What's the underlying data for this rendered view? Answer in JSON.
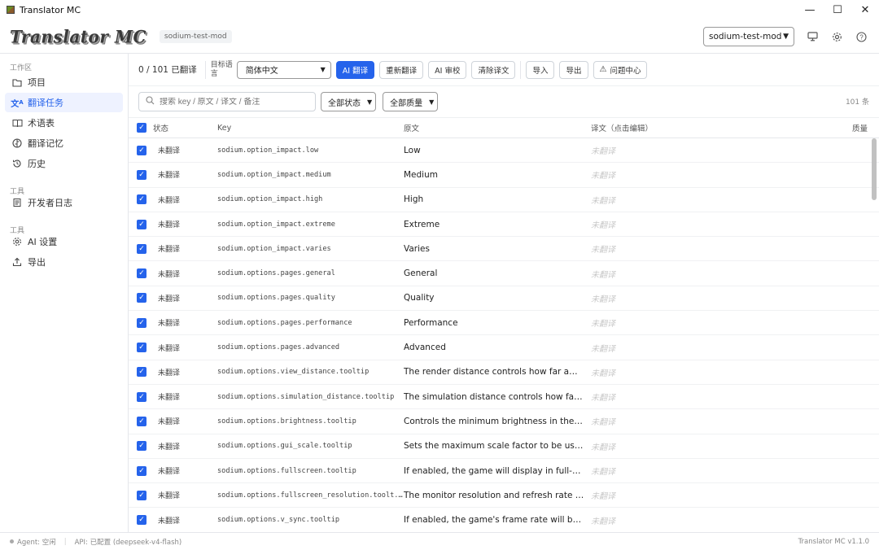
{
  "window": {
    "title": "Translator MC"
  },
  "header": {
    "logo": "Translator MC",
    "project_tag": "sodium-test-mod",
    "project_select": "sodium-test-mod"
  },
  "sidebar": {
    "sections": [
      {
        "title": "工作区",
        "items": [
          {
            "label": "项目",
            "icon": "folder-icon"
          },
          {
            "label": "翻译任务",
            "icon": "translate-icon",
            "active": true
          },
          {
            "label": "术语表",
            "icon": "book-icon"
          },
          {
            "label": "翻译记忆",
            "icon": "brain-icon"
          },
          {
            "label": "历史",
            "icon": "history-icon"
          }
        ]
      },
      {
        "title": "工具",
        "items": [
          {
            "label": "开发者日志",
            "icon": "log-icon"
          }
        ]
      },
      {
        "title": "工具",
        "items": [
          {
            "label": "AI 设置",
            "icon": "gear-icon"
          },
          {
            "label": "导出",
            "icon": "upload-icon"
          }
        ]
      }
    ]
  },
  "toolbar": {
    "progress": "0 / 101 已翻译",
    "target_label": "目标语言",
    "target_lang": "简体中文",
    "ai_translate": "AI 翻译",
    "retranslate": "重新翻译",
    "ai_review": "AI 审校",
    "clear": "清除译文",
    "import": "导入",
    "export": "导出",
    "issues": "问题中心"
  },
  "filters": {
    "search_placeholder": "搜索 key / 原文 / 译文 / 备注",
    "status": "全部状态",
    "quality": "全部质量",
    "count": "101 条"
  },
  "table": {
    "headers": {
      "status": "状态",
      "key": "Key",
      "source": "原文",
      "translation": "译文（点击编辑）",
      "quality": "质量"
    },
    "rows": [
      {
        "status": "未翻译",
        "key": "sodium.option_impact.low",
        "source": "Low",
        "translation": "未翻译"
      },
      {
        "status": "未翻译",
        "key": "sodium.option_impact.medium",
        "source": "Medium",
        "translation": "未翻译"
      },
      {
        "status": "未翻译",
        "key": "sodium.option_impact.high",
        "source": "High",
        "translation": "未翻译"
      },
      {
        "status": "未翻译",
        "key": "sodium.option_impact.extreme",
        "source": "Extreme",
        "translation": "未翻译"
      },
      {
        "status": "未翻译",
        "key": "sodium.option_impact.varies",
        "source": "Varies",
        "translation": "未翻译"
      },
      {
        "status": "未翻译",
        "key": "sodium.options.pages.general",
        "source": "General",
        "translation": "未翻译"
      },
      {
        "status": "未翻译",
        "key": "sodium.options.pages.quality",
        "source": "Quality",
        "translation": "未翻译"
      },
      {
        "status": "未翻译",
        "key": "sodium.options.pages.performance",
        "source": "Performance",
        "translation": "未翻译"
      },
      {
        "status": "未翻译",
        "key": "sodium.options.pages.advanced",
        "source": "Advanced",
        "translation": "未翻译"
      },
      {
        "status": "未翻译",
        "key": "sodium.options.view_distance.tooltip",
        "source": "The render distance controls how far away t...",
        "translation": "未翻译"
      },
      {
        "status": "未翻译",
        "key": "sodium.options.simulation_distance.tooltip",
        "source": "The simulation distance controls how far aw...",
        "translation": "未翻译"
      },
      {
        "status": "未翻译",
        "key": "sodium.options.brightness.tooltip",
        "source": "Controls the minimum brightness in the wor...",
        "translation": "未翻译"
      },
      {
        "status": "未翻译",
        "key": "sodium.options.gui_scale.tooltip",
        "source": "Sets the maximum scale factor to be used fo...",
        "translation": "未翻译"
      },
      {
        "status": "未翻译",
        "key": "sodium.options.fullscreen.tooltip",
        "source": "If enabled, the game will display in full-scree...",
        "translation": "未翻译"
      },
      {
        "status": "未翻译",
        "key": "sodium.options.fullscreen_resolution.toolt...",
        "source": "The monitor resolution and refresh rate to b...",
        "translation": "未翻译"
      },
      {
        "status": "未翻译",
        "key": "sodium.options.v_sync.tooltip",
        "source": "If enabled, the game's frame rate will be syn...",
        "translation": "未翻译"
      }
    ]
  },
  "statusbar": {
    "agent": "Agent: 空闲",
    "api": "API: 已配置 (deepseek-v4-flash)",
    "version": "Translator MC v1.1.0"
  }
}
